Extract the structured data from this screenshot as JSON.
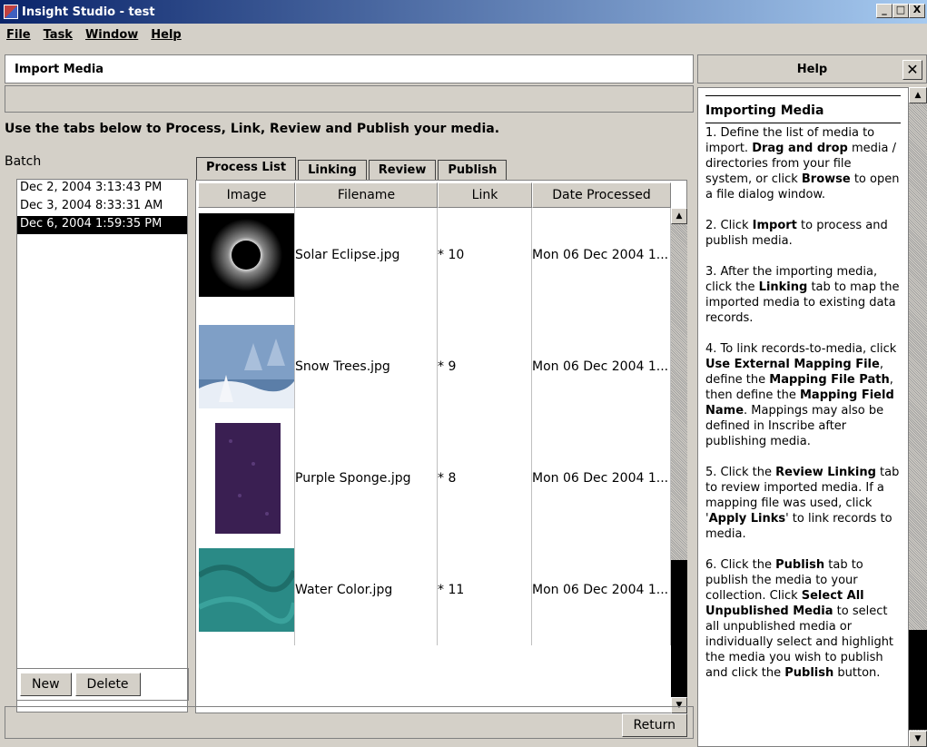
{
  "window": {
    "title": "Insight Studio - test",
    "min": "_",
    "max": "□",
    "close": "X"
  },
  "menu": [
    "File",
    "Task",
    "Window",
    "Help"
  ],
  "panel": {
    "title": "Import Media",
    "instructions": "Use the tabs below to Process, Link, Review and Publish your media."
  },
  "batch": {
    "label": "Batch",
    "items": [
      "Dec 2, 2004 3:13:43 PM",
      "Dec 3, 2004 8:33:31 AM",
      "Dec 6, 2004 1:59:35 PM"
    ],
    "selected_index": 2
  },
  "tabs": [
    "Process List",
    "Linking",
    "Review",
    "Publish"
  ],
  "active_tab": "Process List",
  "table": {
    "columns": [
      "Image",
      "Filename",
      "Link",
      "Date Processed"
    ],
    "rows": [
      {
        "filename": "Solar Eclipse.jpg",
        "link": "* 10",
        "date": "Mon 06 Dec 2004 1...",
        "thumb": "solar-eclipse"
      },
      {
        "filename": "Snow Trees.jpg",
        "link": "* 9",
        "date": "Mon 06 Dec 2004 1...",
        "thumb": "snow-trees"
      },
      {
        "filename": "Purple Sponge.jpg",
        "link": "* 8",
        "date": "Mon 06 Dec 2004 1...",
        "thumb": "purple-sponge"
      },
      {
        "filename": "Water Color.jpg",
        "link": "* 11",
        "date": "Mon 06 Dec 2004 1...",
        "thumb": "water-color"
      }
    ]
  },
  "buttons": {
    "new": "New",
    "delete": "Delete",
    "return": "Return"
  },
  "help": {
    "title": "Help",
    "close": "✕",
    "section_title": "Importing Media",
    "paragraphs": [
      [
        "1. Define the list of media to import. ",
        {
          "b": "Drag and drop"
        },
        " media / directories from your file system, or click ",
        {
          "b": "Browse"
        },
        " to open a file dialog window."
      ],
      [
        "2. Click ",
        {
          "b": "Import"
        },
        " to process and publish media."
      ],
      [
        "3. After the importing media, click the ",
        {
          "b": "Linking"
        },
        " tab to map the imported media to existing data records."
      ],
      [
        "4. To link records-to-media, click ",
        {
          "b": "Use External Mapping File"
        },
        ", define the ",
        {
          "b": "Mapping File Path"
        },
        ", then define the ",
        {
          "b": "Mapping Field Name"
        },
        ". Mappings may also be defined in Inscribe after publishing media."
      ],
      [
        "5. Click the ",
        {
          "b": "Review Linking"
        },
        " tab to review imported media. If a mapping file was used, click '",
        {
          "b": "Apply Links"
        },
        "' to link records to media."
      ],
      [
        "6. Click the ",
        {
          "b": "Publish"
        },
        " tab to publish the media to your collection. Click ",
        {
          "b": "Select All Unpublished Media"
        },
        " to select all unpublished media or individually select and highlight the media you wish to publish and click the ",
        {
          "b": "Publish"
        },
        " button."
      ]
    ]
  },
  "colors": {
    "chrome": "#d4d0c8",
    "title_start": "#0a246a",
    "title_end": "#a6caf0",
    "selection": "#000000"
  }
}
